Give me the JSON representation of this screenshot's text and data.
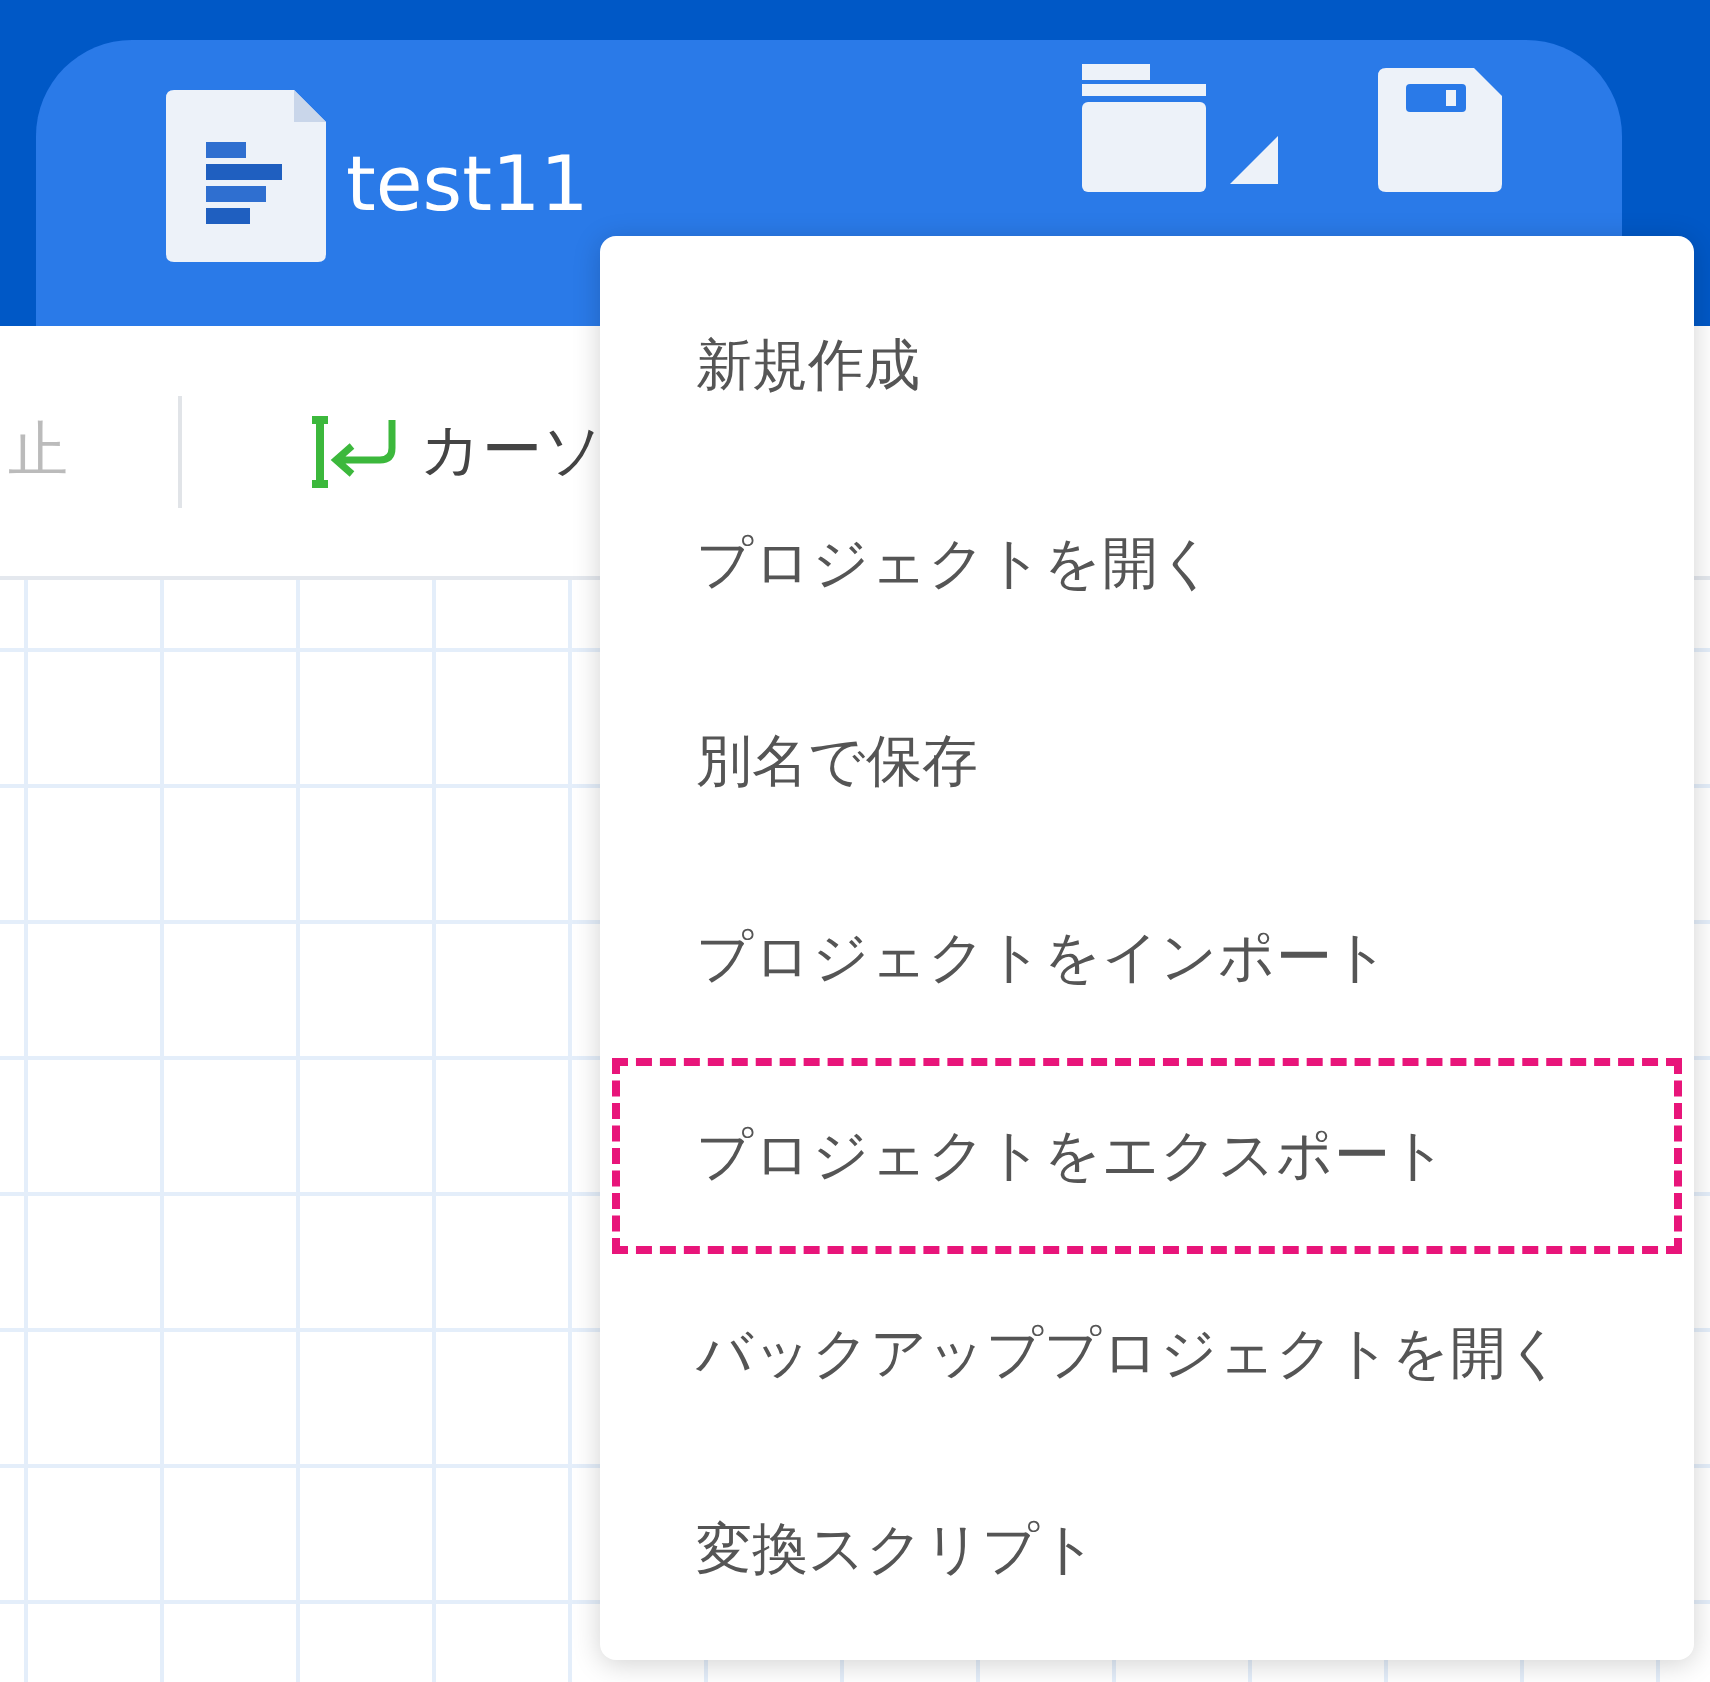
{
  "header": {
    "document_title": "test11",
    "buttons": [
      {
        "kind": "open"
      },
      {
        "kind": "save"
      }
    ]
  },
  "toolbar": {
    "items": [
      {
        "kind": "stop",
        "label": "止",
        "disabled": true
      },
      {
        "kind": "cursor",
        "label": "カーソ",
        "disabled": false
      }
    ]
  },
  "menu": {
    "items": [
      {
        "label": "新規作成",
        "highlighted": false
      },
      {
        "label": "プロジェクトを開く",
        "highlighted": false
      },
      {
        "label": "別名で保存",
        "highlighted": false
      },
      {
        "label": "プロジェクトをインポート",
        "highlighted": false
      },
      {
        "label": "プロジェクトをエクスポート",
        "highlighted": true
      },
      {
        "label": "バックアッププロジェクトを開く",
        "highlighted": false
      },
      {
        "label": "変換スクリプト",
        "highlighted": false
      }
    ]
  }
}
